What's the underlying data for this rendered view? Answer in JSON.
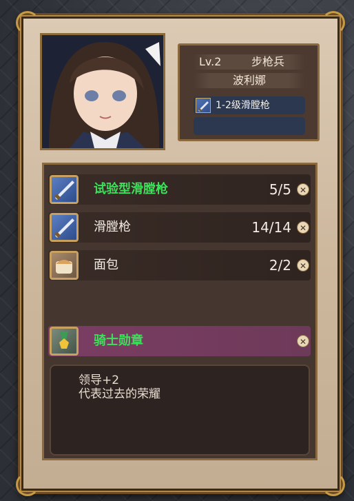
{
  "unit": {
    "level": "Lv.2",
    "class": "步枪兵",
    "name": "波利娜",
    "weapon": "1-2级滑膛枪"
  },
  "items": [
    {
      "name": "试验型滑膛枪",
      "count": "5/5",
      "icon": "rifle-icon",
      "highlight": true
    },
    {
      "name": "滑膛枪",
      "count": "14/14",
      "icon": "rifle-icon",
      "highlight": false
    },
    {
      "name": "面包",
      "count": "2/2",
      "icon": "bread-icon",
      "highlight": false
    }
  ],
  "accessory": {
    "name": "骑士勋章",
    "icon": "medal-icon",
    "description_lines": [
      "领导+2",
      "代表过去的荣耀"
    ]
  },
  "remove_symbol": "✕",
  "colors": {
    "highlight_green": "#3de05a",
    "accessory_row": "#7b3d63",
    "weapon_slot": "#2c3850"
  }
}
